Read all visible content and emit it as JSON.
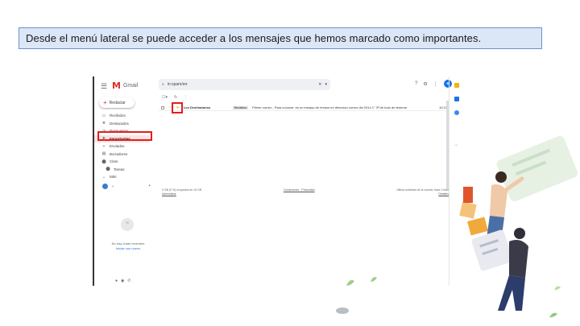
{
  "caption": "Desde el menú lateral se puede acceder a los mensajes que hemos marcado como importantes.",
  "gmail": {
    "logo_text": "Gmail",
    "compose_label": "Redactar",
    "search_value": "in:spam/err",
    "nav": [
      {
        "icon": "inbox-icon",
        "glyph": "▭",
        "label": "Recibidos"
      },
      {
        "icon": "star-icon",
        "glyph": "★",
        "label": "Destacados"
      },
      {
        "icon": "clock-icon",
        "glyph": "◷",
        "label": "Pospuestos"
      },
      {
        "icon": "important-icon",
        "glyph": "➤",
        "label": "Importantes"
      },
      {
        "icon": "send-icon",
        "glyph": "➢",
        "label": "Enviados"
      },
      {
        "icon": "draft-icon",
        "glyph": "▤",
        "label": "Borradores"
      },
      {
        "icon": "label-icon",
        "glyph": "⬤",
        "label": "Citas"
      },
      {
        "icon": "label-icon",
        "glyph": "⬤",
        "label": "Tareas"
      },
      {
        "icon": "expand-icon",
        "glyph": "⌄",
        "label": "Más"
      }
    ],
    "email_row": {
      "from": "Los Destinatarios",
      "tag": "Recibidos",
      "subject": "Primer correo - Para conocer, es un ensayo de revisar en direccion correo del 2014 1° 3ª de todo de tenerse",
      "time": "10:15"
    },
    "footer": {
      "left": [
        "0 GB (0 %) ocupados de 15 GB",
        "Administrar"
      ],
      "mid": "Condiciones · Privacidad",
      "right": [
        "Última actividad de la cuenta: hace 2 días",
        "Detalles"
      ]
    },
    "hangouts_empty": [
      "No hay chats recientes",
      "Iniciar uno nuevo"
    ]
  },
  "colors": {
    "caption_bg": "#dbe6f7",
    "caption_border": "#6f8fcf",
    "highlight_red": "#e02020",
    "gmail_red": "#d93025",
    "active_nav_bg": "#fde3e1"
  }
}
